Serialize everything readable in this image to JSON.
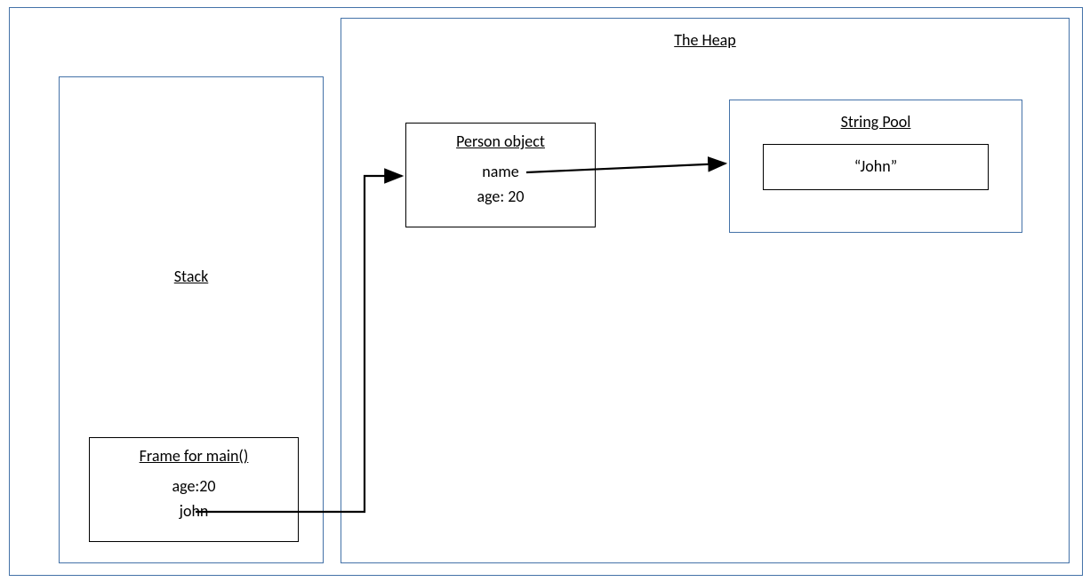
{
  "heap": {
    "title": "The Heap",
    "personObject": {
      "title": "Person object",
      "fields": {
        "name": "name",
        "age": "age: 20"
      }
    },
    "stringPool": {
      "title": "String Pool",
      "value": "“John”"
    }
  },
  "stack": {
    "title": "Stack",
    "frame": {
      "title": "Frame for main()",
      "fields": {
        "age": "age:20",
        "john": "john"
      }
    }
  }
}
